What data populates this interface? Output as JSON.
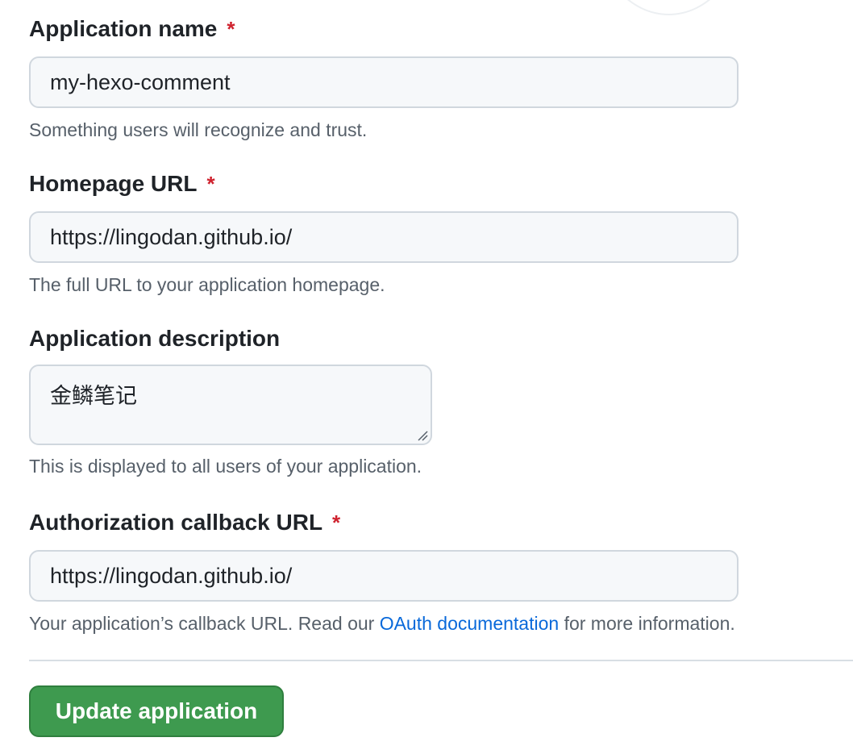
{
  "form": {
    "app_name": {
      "label": "Application name",
      "required_mark": "*",
      "value": "my-hexo-comment",
      "note": "Something users will recognize and trust."
    },
    "homepage_url": {
      "label": "Homepage URL",
      "required_mark": "*",
      "value": "https://lingodan.github.io/",
      "note": "The full URL to your application homepage."
    },
    "description": {
      "label": "Application description",
      "value": "金鳞笔记",
      "note": "This is displayed to all users of your application."
    },
    "callback_url": {
      "label": "Authorization callback URL",
      "required_mark": "*",
      "value": "https://lingodan.github.io/",
      "note_prefix": "Your application’s callback URL. Read our ",
      "note_link": "OAuth documentation",
      "note_suffix": " for more information."
    },
    "submit_label": "Update application"
  },
  "colors": {
    "required": "#cf222e",
    "link": "#0969da",
    "button_bg": "#3e9a4f",
    "input_bg": "#f6f8fa"
  }
}
